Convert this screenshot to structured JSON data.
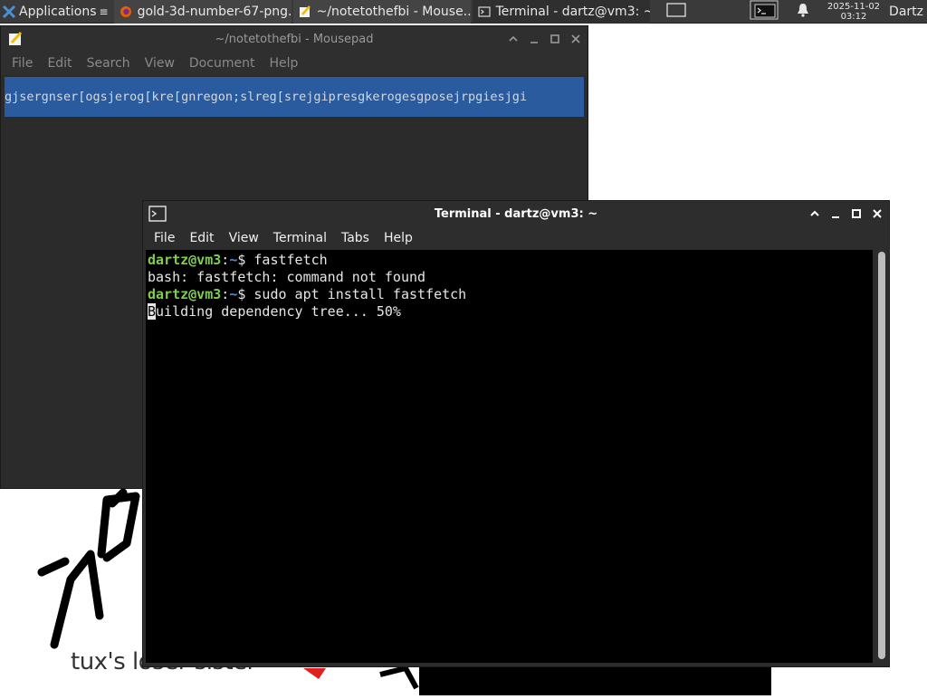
{
  "panel": {
    "applications_label": "Applications",
    "tasks": [
      {
        "label": "gold-3d-number-67-png...",
        "icon": "firefox-icon"
      },
      {
        "label": "~/notetothefbi - Mouse...",
        "icon": "mousepad-icon"
      },
      {
        "label": "Terminal - dartz@vm3: ~",
        "icon": "terminal-icon"
      }
    ],
    "clock_date": "2025-11-02",
    "clock_time": "03:12",
    "user": "Dartz"
  },
  "mousepad": {
    "title": "~/notetothefbi - Mousepad",
    "menu": [
      "File",
      "Edit",
      "Search",
      "View",
      "Document",
      "Help"
    ],
    "content": "gjsergnser[ogsjerog[kre[gnregon;slreg[srejgipresgkerogesgposejrpgiesjgi"
  },
  "terminal": {
    "title": "Terminal - dartz@vm3: ~",
    "menu": [
      "File",
      "Edit",
      "View",
      "Terminal",
      "Tabs",
      "Help"
    ],
    "prompt_user": "dartz@vm3",
    "prompt_sep": ":",
    "prompt_path": "~",
    "prompt_end": "$",
    "cmd1": "fastfetch",
    "out1": "bash: fastfetch: command not found",
    "cmd2": "sudo apt install fastfetch",
    "out2_first": "B",
    "out2_rest": "uilding dependency tree... 50%"
  },
  "wallpaper": {
    "caption": "tux's loser sister"
  },
  "colors": {
    "selection": "#2a5b9e",
    "prompt_user": "#7ed04b",
    "prompt_path": "#4e8fd6"
  }
}
